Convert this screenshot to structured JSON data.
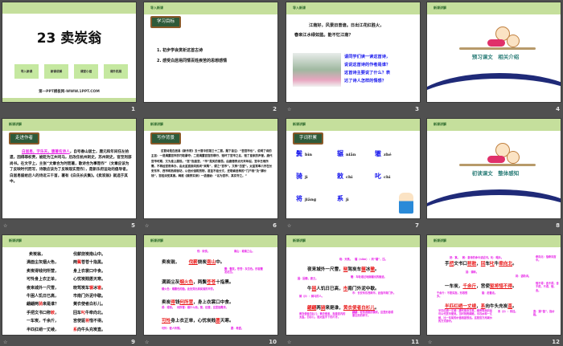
{
  "slides": [
    {
      "number": "1",
      "title": "23 卖炭翁",
      "buttons": [
        "导入新课",
        "新课讲解",
        "课堂小结",
        "课外拓展"
      ],
      "footer": "第一PPT模板网-WWW.1PPT.COM"
    },
    {
      "number": "2",
      "header": "导入新课",
      "badge": "学习目标",
      "items": [
        "1. 初步学会赏析这首古诗",
        "2. 感受白居易同情百姓疾苦的思想感情"
      ]
    },
    {
      "number": "3",
      "header": "导入新课",
      "poem": [
        "江南好，风景旧曾谙。日出江花红胜火，",
        "春来江水绿如蓝。能不忆江南？"
      ],
      "questions": [
        "请同学们读一读这首诗，",
        "说说这首诗的作者是谁？",
        "这首诗主要说了什么？表",
        "达了诗人怎样的情感？"
      ]
    },
    {
      "number": "4",
      "header": "新课讲解",
      "banner": "预习课文　相关介绍"
    },
    {
      "number": "5",
      "header": "新课讲解",
      "badge": "走进作者",
      "highlight": "白居易，字乐天，唐著名诗人",
      "text": "，自号香山居士，唐元和年间任左拾遗，因得罪权贵，被贬为江州司马，后改任杭州刺史，苏州刺史，官至刑部尚书。在文学上，主张“文章合为时而著，歌诗合为事而作”（文章应该为了反映时代而写，诗歌应该为了反映现实而作），是新乐府运动的倡导者。白居易留给后人的诗近三千首，著有《白氏长庆集》。《卖炭翁》就选于其中。"
    },
    {
      "number": "6",
      "header": "新课讲解",
      "badge": "写作背景",
      "text": "这首诗是白居易《新乐府》五十首中的第三十二首。题下自注：“苦宫市也”，说明了诗的主旨：一是揭露宫市的巧取豪夺；二是揭露宫官的罪行，毁坏了宫市之名，毁了皇家的声誉。唐代宫市时期，又为皇上服役。“宫”指皇宫，“市”是买的意思。由唐德宗贞元末年起，宫中日用所需，不再经官府承办，由太监直接向民间“采购”，谓之“宫市”。又称“白望”。太监常率爪牙在长安东市、西市和热闹街坊，以低价强购货物，甚至不给分文，还勒索进奉的“门户钱”及“脚价钱”，百姓深受其害。韩愈《顺宗实录》一语道破：“名为宫市，其实夺之。”"
    },
    {
      "number": "7",
      "header": "新课讲解",
      "badge": "字词积累",
      "vocab": [
        {
          "c": "鬓",
          "p": "bìn"
        },
        {
          "c": "辗",
          "p": "niǎn"
        },
        {
          "c": "辙",
          "p": "zhé"
        },
        {
          "c": "骑",
          "p": "jì"
        },
        {
          "c": "敕",
          "p": "chì"
        },
        {
          "c": "叱",
          "p": "chì"
        },
        {
          "c": "将",
          "p": "jiāng"
        },
        {
          "c": "系",
          "p": "jì"
        }
      ]
    },
    {
      "number": "8",
      "header": "新课讲解",
      "banner": "初读课文　整体感知"
    },
    {
      "number": "9",
      "header": "新课讲解",
      "lines": [
        [
          [
            [
              "卖炭翁，",
              0
            ]
          ],
          [
            [
              "伐薪烧炭南山中。",
              0
            ]
          ]
        ],
        [
          [
            [
              "满面尘灰烟火色，",
              0
            ]
          ],
          [
            [
              "两",
              0
            ],
            [
              "鬓",
              1
            ],
            [
              "苍苍十指黑。",
              0
            ]
          ]
        ],
        [
          [
            [
              "卖炭得钱何所营，",
              0
            ]
          ],
          [
            [
              "身上衣裳口中食。",
              0
            ]
          ]
        ],
        [
          [
            [
              "可怜身上衣正单，",
              0
            ]
          ],
          [
            [
              "心忧炭贱愿天寒。",
              0
            ]
          ]
        ],
        [
          [
            [
              "夜来城外一尺雪，",
              0
            ]
          ],
          [
            [
              "晓驾炭车",
              0
            ],
            [
              "辗",
              1
            ],
            [
              "冰",
              0
            ],
            [
              "辙",
              1
            ],
            [
              "。",
              0
            ]
          ]
        ],
        [
          [
            [
              "牛困人饥日已高，",
              0
            ]
          ],
          [
            [
              "市南门外泥中歇。",
              0
            ]
          ]
        ],
        [
          [
            [
              "翩翩两",
              0
            ],
            [
              "骑",
              1
            ],
            [
              "来是谁？",
              0
            ]
          ],
          [
            [
              "黄衣使者白衫儿。",
              0
            ]
          ]
        ],
        [
          [
            [
              "手把文书口称",
              0
            ],
            [
              "敕",
              1
            ],
            [
              "，",
              0
            ]
          ],
          [
            [
              "回车",
              0
            ],
            [
              "叱",
              1
            ],
            [
              "牛牵向北。",
              0
            ]
          ]
        ],
        [
          [
            [
              "一车炭，千余斤，",
              0
            ]
          ],
          [
            [
              "宫使驱",
              0
            ],
            [
              "将",
              1
            ],
            [
              "惜不得。",
              0
            ]
          ]
        ],
        [
          [
            [
              "半匹红绡一丈绫，",
              0
            ]
          ],
          [
            [
              "系",
              1
            ],
            [
              "向牛头充炭直。",
              0
            ]
          ]
        ]
      ]
    },
    {
      "number": "10",
      "header": "新课讲解",
      "lines": [
        [
          [
            "卖炭翁，　　",
            0
          ],
          [
            "伐薪",
            1
          ],
          [
            "烧炭",
            0
          ],
          [
            "南山",
            1
          ],
          [
            "中。",
            0
          ]
        ],
        [
          [
            "满面尘灰",
            0
          ],
          [
            "烟火色",
            1
          ],
          [
            "，两鬓",
            0
          ],
          [
            "苍苍",
            1
          ],
          [
            "十指黑。",
            0
          ]
        ],
        [
          [
            "卖炭",
            0
          ],
          [
            "得",
            1
          ],
          [
            "钱",
            0
          ],
          [
            "何所营",
            1
          ],
          [
            "，身上衣裳口中食。",
            0
          ]
        ],
        [
          [
            "可怜",
            1
          ],
          [
            "身上衣正单，心忧炭贱",
            0
          ],
          [
            "愿",
            1
          ],
          [
            "天寒。",
            0
          ]
        ]
      ],
      "notes": [
        "伐：砍伐。",
        "南山：城南之山。",
        "鬓：鬓发。苍苍：灰白色。形容鬓发花白。",
        "烟火色：烟熏色的脸。此处突出卖炭翁的辛劳。",
        "得：得到。　何所营：做什么用。营，经营，这里指需求。",
        "可怜：使人怜悯。",
        "愿：希望。"
      ]
    },
    {
      "number": "11",
      "header": "新课讲解",
      "lines": [
        [
          [
            "夜来城外一尺雪，",
            0
          ],
          [
            "晓",
            1
          ],
          [
            "驾炭车",
            0
          ],
          [
            "辗",
            1
          ],
          [
            "冰",
            0
          ],
          [
            "辙",
            1
          ],
          [
            "。",
            0
          ]
        ],
        [
          [
            "牛",
            0
          ],
          [
            "困",
            1
          ],
          [
            "人饥日已高，",
            0
          ],
          [
            "市",
            1
          ],
          [
            "南门外泥中歇。",
            0
          ]
        ],
        [
          [
            "翩翩",
            1
          ],
          [
            "两",
            0
          ],
          [
            "骑",
            1
          ],
          [
            "来是谁，",
            0
          ],
          [
            "黄衣使者白衫儿",
            1
          ],
          [
            "。",
            0
          ]
        ]
      ],
      "notes": [
        "晓：天亮。　辗（niǎn）：同“碾”，压。",
        "辙：车轮滚过地面碾出的痕迹。",
        "困：困倦，疲乏。",
        "市：长安有东西两市，此指市南门外。",
        "骑（jì）：骑马的人。",
        "翩翩：轻快洒脱的情状。这里形容得意忘形的样子。",
        "黄衣使者白衫儿：黄衣使者，指皇宫内的太监。白衫儿，指太监手下的爪牙。"
      ]
    },
    {
      "number": "12",
      "header": "新课讲解",
      "lines": [
        [
          [
            "手",
            0
          ],
          [
            "把",
            1
          ],
          [
            "文书口",
            0
          ],
          [
            "称敕",
            1
          ],
          [
            "，",
            0
          ],
          [
            "回",
            1
          ],
          [
            "车",
            0
          ],
          [
            "叱",
            1
          ],
          [
            "牛",
            0
          ],
          [
            "牵向北",
            1
          ],
          [
            "。",
            0
          ]
        ],
        [
          [
            "一车炭，",
            0
          ],
          [
            "千余斤",
            1
          ],
          [
            "，宫使",
            0
          ],
          [
            "驱将惜不得",
            1
          ],
          [
            "。",
            0
          ]
        ],
        [
          [
            "半匹红绡一丈绫",
            1
          ],
          [
            "，",
            0
          ],
          [
            "系",
            1
          ],
          [
            "向牛头充炭",
            0
          ],
          [
            "直",
            1
          ],
          [
            "。",
            0
          ]
        ]
      ],
      "notes": [
        "把：拿。　敕：皇帝的命令或诏书。叱：喝斥。",
        "牵向北：指牵向宫中。",
        "回：调转。",
        "将：语助词。",
        "惜不得：舍不得，舍不得，不得，惜，舍。",
        "千余斤：不是实指，形容很多。",
        "驱：赶着走。",
        "半匹红绡一丈绫：唐代商业交易，绢帛等丝织品可以代货币使用。当时钱贵绢贱，半匹纱和一丈绫，比一车炭的价值相差很远。这是官方用减价的方式掠夺。",
        "系（jì）：系挂。",
        "直：通“值”，指价格。"
      ]
    }
  ],
  "colors": {
    "header": "#c5df9c",
    "magenta": "#e61ee6",
    "red": "#e81818",
    "blue": "#1a1aee"
  }
}
